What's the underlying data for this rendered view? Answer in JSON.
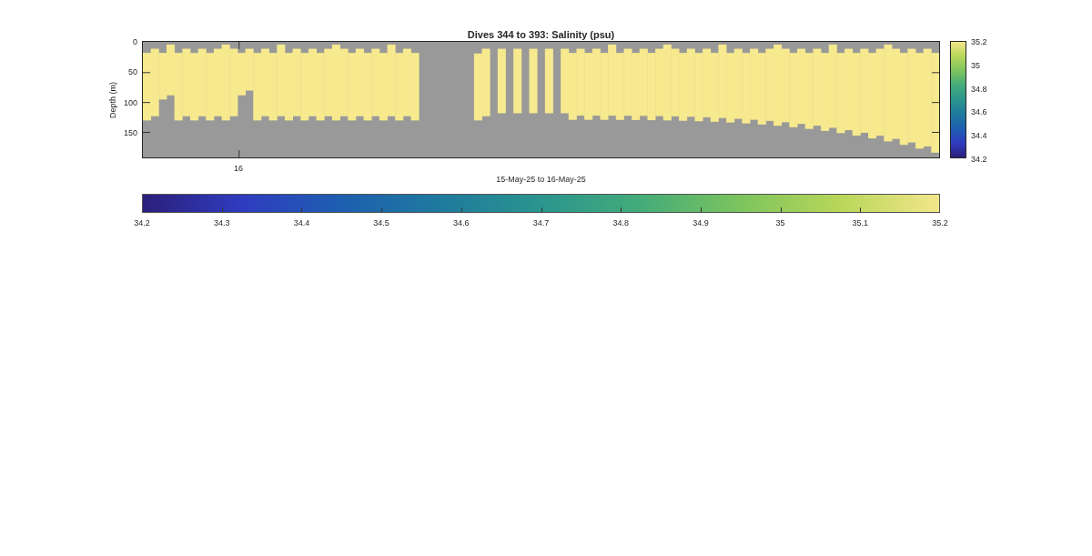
{
  "title": "Dives 344 to 393: Salinity (psu)",
  "y_axis": {
    "label": "Depth (m)",
    "ticks": [
      "0",
      "50",
      "100",
      "150"
    ]
  },
  "x_axis": {
    "ticks": [
      "16"
    ],
    "label": "15-May-25 to 16-May-25"
  },
  "colorbar": {
    "ticks": [
      "35.2",
      "35",
      "34.8",
      "34.6",
      "34.4",
      "34.2"
    ]
  },
  "colorbar_horizontal": {
    "ticks": [
      "34.2",
      "34.3",
      "34.4",
      "34.5",
      "34.6",
      "34.7",
      "34.8",
      "34.9",
      "35",
      "35.1",
      "35.2"
    ]
  }
}
